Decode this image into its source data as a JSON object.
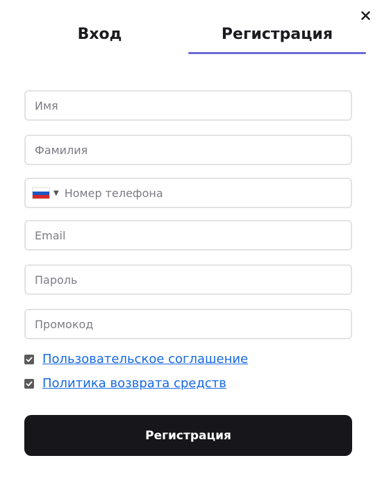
{
  "colors": {
    "accent_underline": "#6b6ad8",
    "link": "#1668e3",
    "button_bg": "#16161b",
    "field_border": "#e3e3e6"
  },
  "close": {
    "icon": "close-icon",
    "glyph": "✕"
  },
  "tabs": [
    {
      "label": "Вход",
      "active": false
    },
    {
      "label": "Регистрация",
      "active": true
    }
  ],
  "form": {
    "first_name": {
      "placeholder": "Имя",
      "value": ""
    },
    "last_name": {
      "placeholder": "Фамилия",
      "value": ""
    },
    "phone": {
      "country_flag": "flag-russia-icon",
      "placeholder": "Номер телефона",
      "value": ""
    },
    "email": {
      "placeholder": "Email",
      "value": ""
    },
    "password": {
      "placeholder": "Пароль",
      "value": ""
    },
    "promo": {
      "placeholder": "Промокод",
      "value": ""
    }
  },
  "agreements": [
    {
      "label": "Пользовательское соглашение",
      "checked": true
    },
    {
      "label": "Политика возврата средств",
      "checked": true
    }
  ],
  "submit_label": "Регистрация"
}
